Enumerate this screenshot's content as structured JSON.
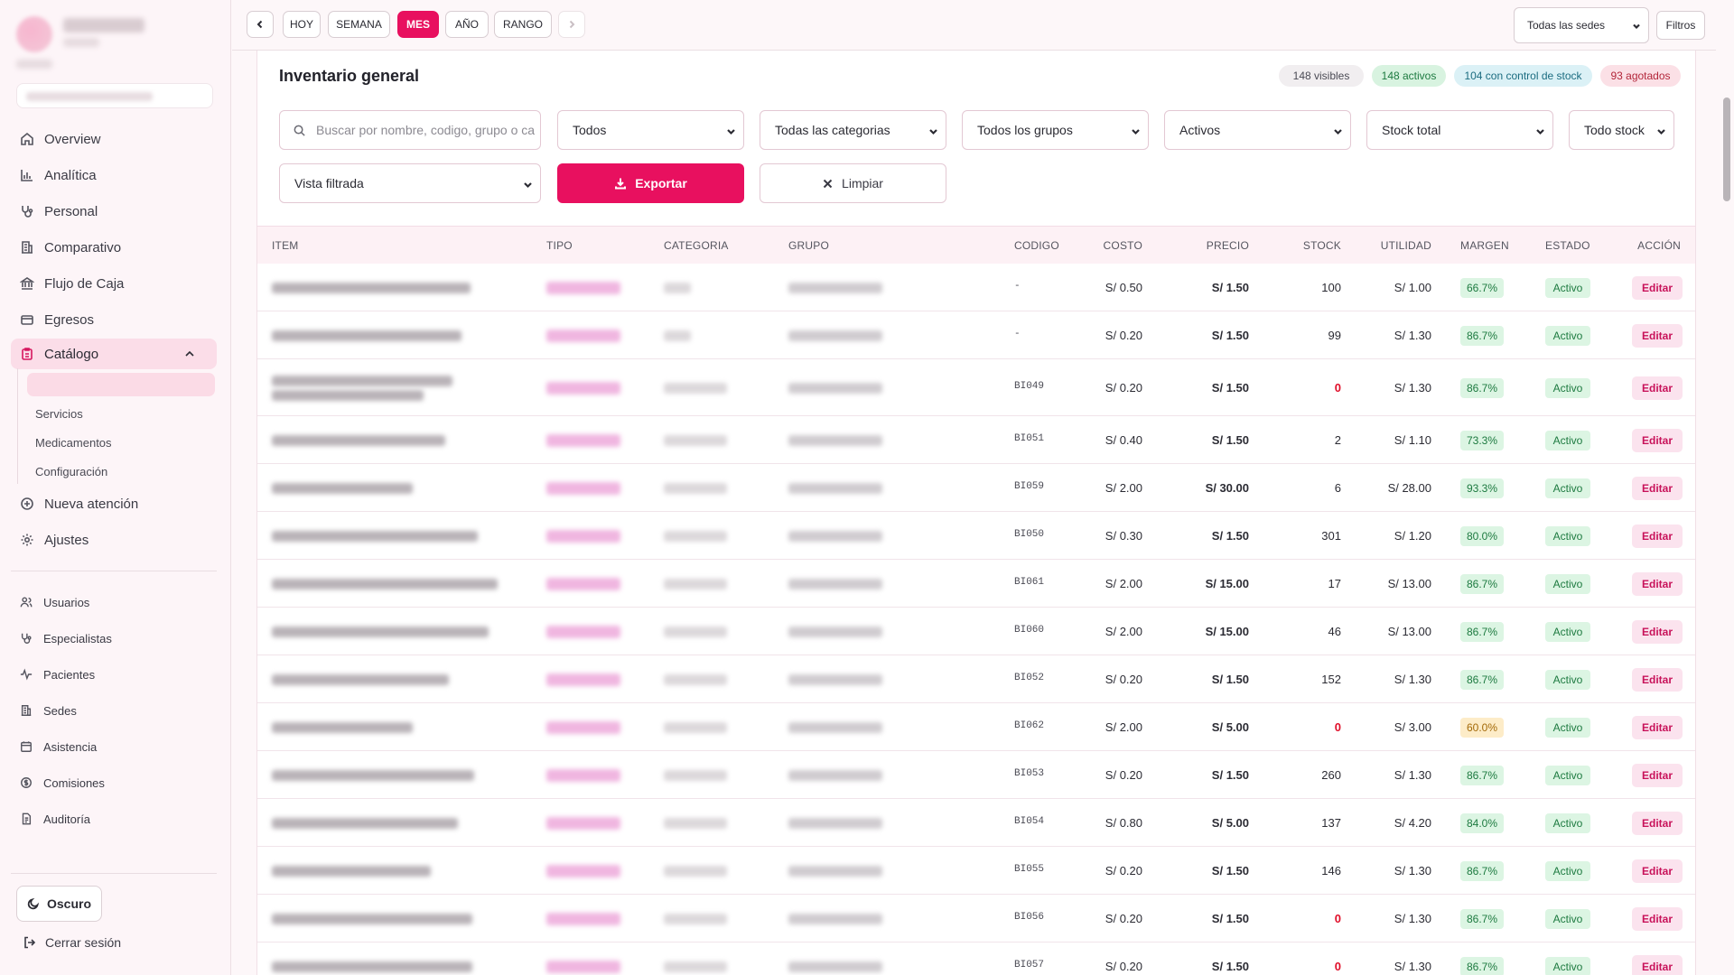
{
  "sidebar": {
    "nav": [
      {
        "label": "Overview",
        "icon": "home-icon"
      },
      {
        "label": "Analítica",
        "icon": "bar-chart-icon"
      },
      {
        "label": "Personal",
        "icon": "stethoscope-icon"
      },
      {
        "label": "Comparativo",
        "icon": "building-icon"
      },
      {
        "label": "Flujo de Caja",
        "icon": "bank-icon"
      },
      {
        "label": "Egresos",
        "icon": "credit-card-icon"
      },
      {
        "label": "Catálogo",
        "icon": "clipboard-icon"
      }
    ],
    "catalog_sub": [
      "Servicios",
      "Medicamentos",
      "Configuración"
    ],
    "nav_after": [
      {
        "label": "Nueva atención",
        "icon": "plus-circle-icon"
      },
      {
        "label": "Ajustes",
        "icon": "gear-icon"
      }
    ],
    "admin": [
      {
        "label": "Usuarios",
        "icon": "users-icon"
      },
      {
        "label": "Especialistas",
        "icon": "stethoscope-icon"
      },
      {
        "label": "Pacientes",
        "icon": "activity-icon"
      },
      {
        "label": "Sedes",
        "icon": "building-icon"
      },
      {
        "label": "Asistencia",
        "icon": "calendar-icon"
      },
      {
        "label": "Comisiones",
        "icon": "coin-icon"
      },
      {
        "label": "Auditoría",
        "icon": "document-icon"
      }
    ],
    "theme_label": "Oscuro",
    "logout_label": "Cerrar sesión"
  },
  "topbar": {
    "periods": [
      "HOY",
      "SEMANA",
      "MES",
      "AÑO",
      "RANGO"
    ],
    "active_period": "MES",
    "sede": "Todas las sedes",
    "filters": "Filtros"
  },
  "inventory": {
    "title": "Inventario general",
    "stats": {
      "visible": "148 visibles",
      "active": "148 activos",
      "stock_control": "104 con control de stock",
      "out_of_stock": "93 agotados"
    },
    "search_placeholder": "Buscar por nombre, codigo, grupo o ca",
    "filters": {
      "type": "Todos",
      "category": "Todas las categorias",
      "group": "Todos los grupos",
      "status": "Activos",
      "stock_mode": "Stock total",
      "stock": "Todo stock",
      "view": "Vista filtrada"
    },
    "export_label": "Exportar",
    "clear_label": "Limpiar",
    "columns": [
      "ITEM",
      "TIPO",
      "CATEGORIA",
      "GRUPO",
      "CODIGO",
      "COSTO",
      "PRECIO",
      "STOCK",
      "UTILIDAD",
      "MARGEN",
      "ESTADO",
      "ACCIÓN"
    ],
    "rows": [
      {
        "code": "-",
        "cost": "S/ 0.50",
        "price": "S/ 1.50",
        "stock": "100",
        "utility": "S/ 1.00",
        "margin": "66.7%",
        "status": "Activo",
        "action": "Editar"
      },
      {
        "code": "-",
        "cost": "S/ 0.20",
        "price": "S/ 1.50",
        "stock": "99",
        "utility": "S/ 1.30",
        "margin": "86.7%",
        "status": "Activo",
        "action": "Editar"
      },
      {
        "code": "BI049",
        "cost": "S/ 0.20",
        "price": "S/ 1.50",
        "stock": "0",
        "utility": "S/ 1.30",
        "margin": "86.7%",
        "status": "Activo",
        "action": "Editar"
      },
      {
        "code": "BI051",
        "cost": "S/ 0.40",
        "price": "S/ 1.50",
        "stock": "2",
        "utility": "S/ 1.10",
        "margin": "73.3%",
        "status": "Activo",
        "action": "Editar"
      },
      {
        "code": "BI059",
        "cost": "S/ 2.00",
        "price": "S/ 30.00",
        "stock": "6",
        "utility": "S/ 28.00",
        "margin": "93.3%",
        "status": "Activo",
        "action": "Editar"
      },
      {
        "code": "BI050",
        "cost": "S/ 0.30",
        "price": "S/ 1.50",
        "stock": "301",
        "utility": "S/ 1.20",
        "margin": "80.0%",
        "status": "Activo",
        "action": "Editar"
      },
      {
        "code": "BI061",
        "cost": "S/ 2.00",
        "price": "S/ 15.00",
        "stock": "17",
        "utility": "S/ 13.00",
        "margin": "86.7%",
        "status": "Activo",
        "action": "Editar"
      },
      {
        "code": "BI060",
        "cost": "S/ 2.00",
        "price": "S/ 15.00",
        "stock": "46",
        "utility": "S/ 13.00",
        "margin": "86.7%",
        "status": "Activo",
        "action": "Editar"
      },
      {
        "code": "BI052",
        "cost": "S/ 0.20",
        "price": "S/ 1.50",
        "stock": "152",
        "utility": "S/ 1.30",
        "margin": "86.7%",
        "status": "Activo",
        "action": "Editar"
      },
      {
        "code": "BI062",
        "cost": "S/ 2.00",
        "price": "S/ 5.00",
        "stock": "0",
        "utility": "S/ 3.00",
        "margin": "60.0%",
        "status": "Activo",
        "action": "Editar"
      },
      {
        "code": "BI053",
        "cost": "S/ 0.20",
        "price": "S/ 1.50",
        "stock": "260",
        "utility": "S/ 1.30",
        "margin": "86.7%",
        "status": "Activo",
        "action": "Editar"
      },
      {
        "code": "BI054",
        "cost": "S/ 0.80",
        "price": "S/ 5.00",
        "stock": "137",
        "utility": "S/ 4.20",
        "margin": "84.0%",
        "status": "Activo",
        "action": "Editar"
      },
      {
        "code": "BI055",
        "cost": "S/ 0.20",
        "price": "S/ 1.50",
        "stock": "146",
        "utility": "S/ 1.30",
        "margin": "86.7%",
        "status": "Activo",
        "action": "Editar"
      },
      {
        "code": "BI056",
        "cost": "S/ 0.20",
        "price": "S/ 1.50",
        "stock": "0",
        "utility": "S/ 1.30",
        "margin": "86.7%",
        "status": "Activo",
        "action": "Editar"
      },
      {
        "code": "BI057",
        "cost": "S/ 0.20",
        "price": "S/ 1.50",
        "stock": "0",
        "utility": "S/ 1.30",
        "margin": "86.7%",
        "status": "Activo",
        "action": "Editar"
      }
    ]
  },
  "colors": {
    "accent": "#e8105f",
    "active_nav_bg": "#fbdde8",
    "stock_zero": "#e00f2a",
    "margin_green_bg": "#dcf5e3",
    "margin_yellow_bg": "#fdecc8"
  }
}
